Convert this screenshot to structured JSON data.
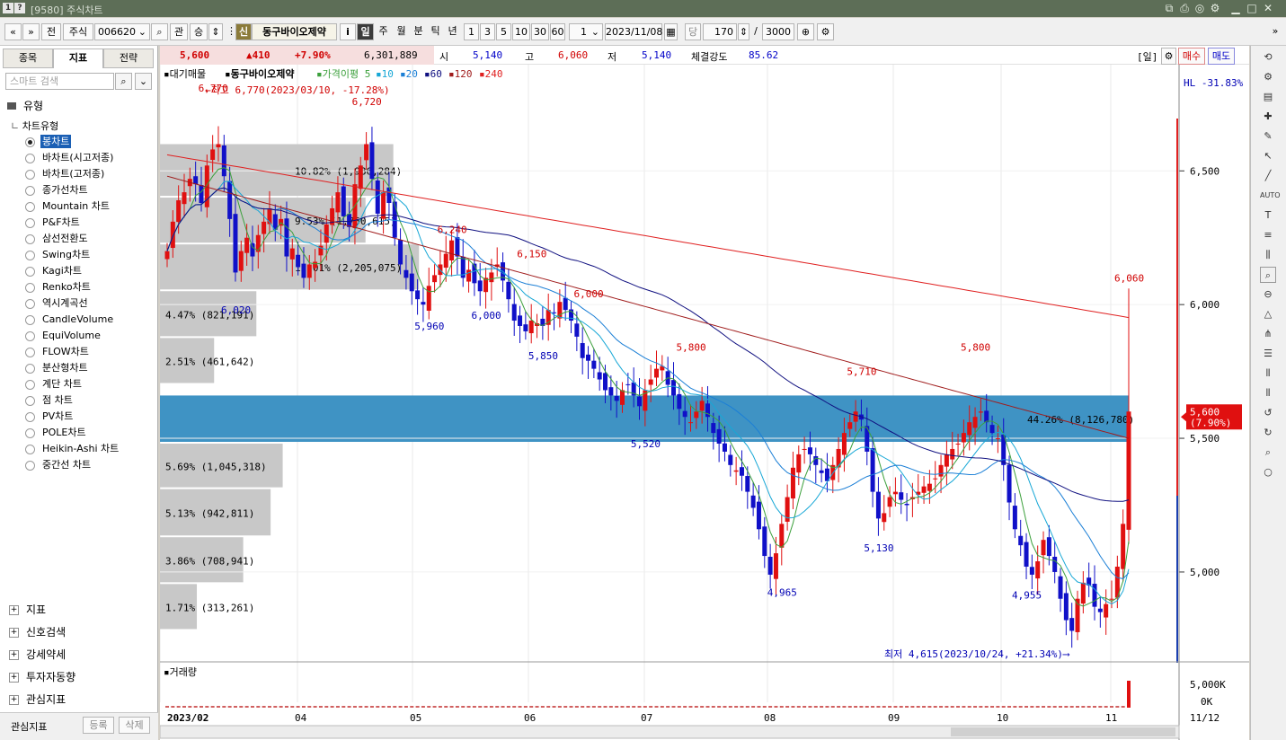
{
  "window": {
    "title": "[9580] 주식차트",
    "help_badge": "?",
    "num_badge": "1"
  },
  "toolbar": {
    "prev": "«",
    "next": "»",
    "jeon": "전",
    "market": "주식",
    "code": "006620",
    "gwan": "관",
    "seung": "승",
    "credit_badge": "신",
    "stock_name": "동구바이오제약",
    "info": "i",
    "periods": [
      "일",
      "주",
      "월",
      "분",
      "틱",
      "년"
    ],
    "intervals": [
      "1",
      "3",
      "5",
      "10",
      "30",
      "60"
    ],
    "interval_value": "1",
    "date": "2023/11/08",
    "dang": "당",
    "count": "170",
    "slash": "/",
    "max_count": "3000"
  },
  "left": {
    "tabs": [
      "종목",
      "지표",
      "전략"
    ],
    "search_placeholder": "스마트 검색",
    "section_type": "유형",
    "chart_type_header": "차트유형",
    "chart_types": [
      "봉차트",
      "바차트(시고저종)",
      "바차트(고저종)",
      "종가선차트",
      "Mountain 차트",
      "P&F차트",
      "삼선전환도",
      "Swing차트",
      "Kagi차트",
      "Renko차트",
      "역시계곡선",
      "CandleVolume",
      "EquiVolume",
      "FLOW차트",
      "분산형차트",
      "계단 차트",
      "점 차트",
      "PV차트",
      "POLE차트",
      "Heikin-Ashi 차트",
      "중간선 차트"
    ],
    "groups": [
      "지표",
      "신호검색",
      "강세약세",
      "투자자동향",
      "관심지표"
    ],
    "bottom_label": "관심지표",
    "register": "등록",
    "delete": "삭제"
  },
  "quote": {
    "price": "5,600",
    "change": "▲410",
    "pct": "+7.90%",
    "volume": "6,301,889",
    "open_label": "시",
    "open": "5,140",
    "high_label": "고",
    "high": "6,060",
    "low_label": "저",
    "low": "5,140",
    "strength_label": "체결강도",
    "strength": "85.62",
    "period_tag": "[일]",
    "buy": "매수",
    "sell": "매도"
  },
  "legend": {
    "main": "대기매물",
    "name": "동구바이오제약",
    "ma_label": "가격이평",
    "ma": [
      "5",
      "10",
      "20",
      "60",
      "120",
      "240"
    ],
    "ma_colors": [
      "#3ca03c",
      "#17a7d6",
      "#1b7fd6",
      "#101080",
      "#a01c1c",
      "#e02020"
    ]
  },
  "annotations": {
    "high_note": "←최고 6,770(2023/03/10, -17.28%)",
    "low_note": "최저 4,615(2023/10/24, +21.34%)⟶",
    "hl": "HL -31.83%"
  },
  "chart_data": {
    "type": "candlestick",
    "x_ticks": [
      "2023/02",
      "04",
      "05",
      "06",
      "07",
      "08",
      "09",
      "10",
      "11"
    ],
    "y_ticks": [
      "6,500",
      "6,000",
      "5,500",
      "5,000"
    ],
    "ylim": [
      4580,
      6830
    ],
    "current_label": "5,600",
    "current_pct": "(7.90%)",
    "price_labels": [
      {
        "text": "6,770",
        "value": 6770,
        "idx": 8,
        "color": "red"
      },
      {
        "text": "6,720",
        "value": 6720,
        "idx": 35,
        "color": "red"
      },
      {
        "text": "6,240",
        "value": 6240,
        "idx": 50,
        "color": "red"
      },
      {
        "text": "6,150",
        "value": 6150,
        "idx": 64,
        "color": "red"
      },
      {
        "text": "6,000",
        "value": 6000,
        "idx": 74,
        "color": "red"
      },
      {
        "text": "5,800",
        "value": 5800,
        "idx": 92,
        "color": "red"
      },
      {
        "text": "5,710",
        "value": 5710,
        "idx": 122,
        "color": "red"
      },
      {
        "text": "5,800",
        "value": 5800,
        "idx": 142,
        "color": "red"
      },
      {
        "text": "6,060",
        "value": 6060,
        "idx": 169,
        "color": "red"
      },
      {
        "text": "6,020",
        "value": 6020,
        "idx": 12,
        "color": "blue"
      },
      {
        "text": "5,960",
        "value": 5960,
        "idx": 46,
        "color": "blue"
      },
      {
        "text": "6,000",
        "value": 6000,
        "idx": 56,
        "color": "blue"
      },
      {
        "text": "5,850",
        "value": 5850,
        "idx": 66,
        "color": "blue"
      },
      {
        "text": "5,520",
        "value": 5520,
        "idx": 84,
        "color": "blue"
      },
      {
        "text": "4,965",
        "value": 4965,
        "idx": 108,
        "color": "blue"
      },
      {
        "text": "5,130",
        "value": 5130,
        "idx": 125,
        "color": "blue"
      },
      {
        "text": "4,955",
        "value": 4955,
        "idx": 151,
        "color": "blue"
      }
    ],
    "volume_profile": [
      {
        "label": "10.82% (1,986,284)",
        "pct": 10.82,
        "lo": 6400,
        "hi": 6600,
        "highlight": false
      },
      {
        "label": "9.53% (1,750,615)",
        "pct": 9.53,
        "lo": 6225,
        "hi": 6400,
        "highlight": false
      },
      {
        "label": "12.01% (2,205,075)",
        "pct": 12.01,
        "lo": 6050,
        "hi": 6225,
        "highlight": false
      },
      {
        "label": "4.47% (821,191)",
        "pct": 4.47,
        "lo": 5875,
        "hi": 6050,
        "highlight": false
      },
      {
        "label": "2.51% (461,642)",
        "pct": 2.51,
        "lo": 5700,
        "hi": 5875,
        "highlight": false
      },
      {
        "label": "44.26% (8,126,780)",
        "pct": 44.26,
        "lo": 5480,
        "hi": 5660,
        "highlight": true
      },
      {
        "label": "5.69% (1,045,318)",
        "pct": 5.69,
        "lo": 5310,
        "hi": 5480,
        "highlight": false
      },
      {
        "label": "5.13% (942,811)",
        "pct": 5.13,
        "lo": 5130,
        "hi": 5310,
        "highlight": false
      },
      {
        "label": "3.86% (708,941)",
        "pct": 3.86,
        "lo": 4955,
        "hi": 5130,
        "highlight": false
      },
      {
        "label": "1.71% (313,261)",
        "pct": 1.71,
        "lo": 4780,
        "hi": 4955,
        "highlight": false
      }
    ],
    "closes": [
      6200,
      6310,
      6390,
      6420,
      6470,
      6450,
      6380,
      6520,
      6580,
      6600,
      6480,
      6320,
      6120,
      6200,
      6250,
      6180,
      6260,
      6310,
      6360,
      6280,
      6320,
      6180,
      6210,
      6140,
      6100,
      6150,
      6160,
      6220,
      6300,
      6360,
      6420,
      6330,
      6290,
      6450,
      6520,
      6600,
      6470,
      6340,
      6420,
      6380,
      6250,
      6150,
      6100,
      6050,
      6020,
      6000,
      6070,
      6110,
      6150,
      6190,
      6240,
      6180,
      6100,
      6130,
      6080,
      6050,
      6100,
      6120,
      6150,
      6090,
      6020,
      5940,
      5920,
      5900,
      5940,
      5930,
      5920,
      5980,
      5970,
      6010,
      5980,
      5940,
      5880,
      5800,
      5790,
      5760,
      5720,
      5680,
      5660,
      5640,
      5680,
      5700,
      5660,
      5620,
      5680,
      5720,
      5760,
      5770,
      5700,
      5660,
      5610,
      5580,
      5560,
      5600,
      5640,
      5580,
      5520,
      5480,
      5450,
      5400,
      5380,
      5360,
      5300,
      5240,
      5160,
      5060,
      4990,
      5070,
      5180,
      5280,
      5390,
      5440,
      5460,
      5440,
      5400,
      5370,
      5340,
      5400,
      5460,
      5520,
      5560,
      5600,
      5570,
      5450,
      5300,
      5200,
      5220,
      5280,
      5300,
      5270,
      5250,
      5280,
      5300,
      5320,
      5330,
      5350,
      5400,
      5440,
      5460,
      5480,
      5520,
      5560,
      5580,
      5600,
      5560,
      5520,
      5500,
      5400,
      5260,
      5160,
      5100,
      5020,
      4990,
      5040,
      5120,
      5060,
      5000,
      4900,
      4820,
      4780,
      4900,
      4960,
      4950,
      4870,
      4850,
      4880,
      4900,
      5020,
      5180,
      5600
    ],
    "volume_ylim": [
      0,
      5000
    ],
    "volume_ticks": [
      "5,000K",
      "0K"
    ],
    "volume_title": "거래량",
    "hl_ratio": "HL -31.83%",
    "date_label": "11/12"
  }
}
